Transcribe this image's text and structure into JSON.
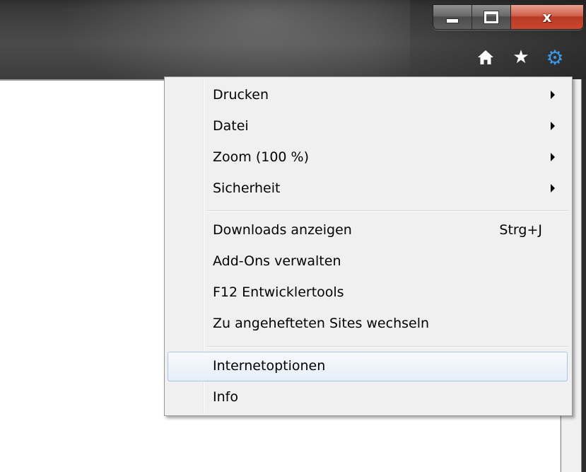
{
  "window": {
    "caption_buttons": {
      "minimize_icon": "minimize-icon",
      "maximize_icon": "maximize-icon",
      "close_icon": "close-icon",
      "close_glyph": "x"
    },
    "toolbar": {
      "home_icon": "home-icon",
      "favorites_icon": "star-icon",
      "tools_icon": "gear-icon",
      "favorites_glyph": "★",
      "tools_glyph": "⚙"
    }
  },
  "tools_menu": {
    "groups": [
      {
        "items": [
          {
            "label": "Drucken",
            "submenu": true
          },
          {
            "label": "Datei",
            "submenu": true
          },
          {
            "label": "Zoom (100 %)",
            "submenu": true
          },
          {
            "label": "Sicherheit",
            "submenu": true
          }
        ]
      },
      {
        "items": [
          {
            "label": "Downloads anzeigen",
            "shortcut": "Strg+J"
          },
          {
            "label": "Add-Ons verwalten"
          },
          {
            "label": "F12 Entwicklertools"
          },
          {
            "label": "Zu angehefteten Sites wechseln"
          }
        ]
      },
      {
        "items": [
          {
            "label": "Internetoptionen",
            "highlighted": true
          },
          {
            "label": "Info"
          }
        ]
      }
    ]
  },
  "colors": {
    "highlight_border": "#a8c7ea",
    "gear_icon": "#3b98e8",
    "close_button": "#c9472e"
  }
}
